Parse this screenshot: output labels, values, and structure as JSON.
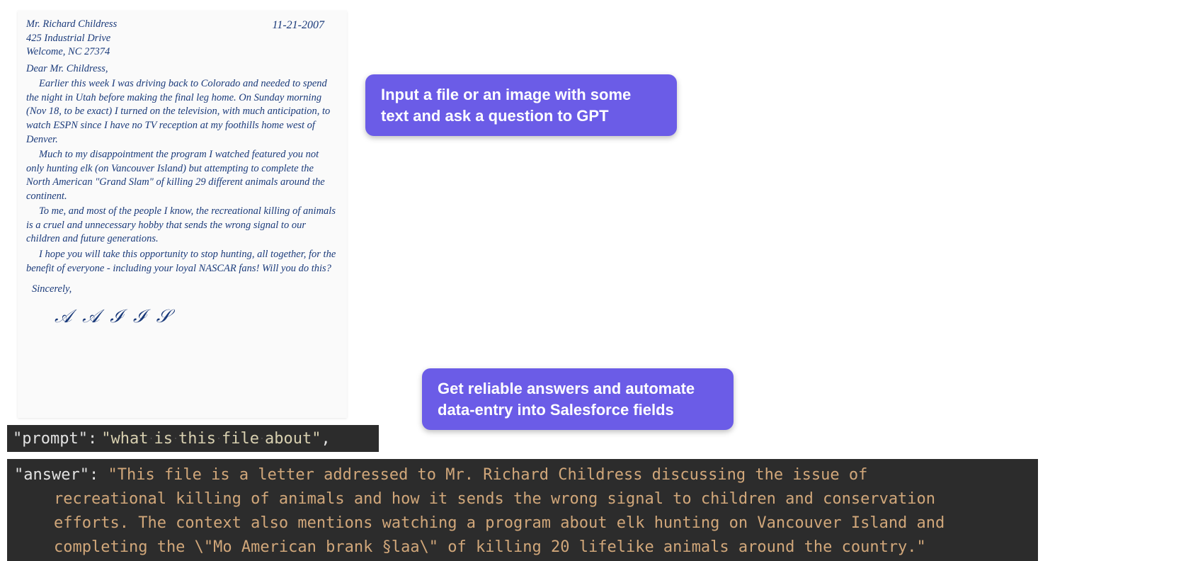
{
  "letter": {
    "name": "Mr. Richard Childress",
    "addr1": "425 Industrial Drive",
    "addr2": "Welcome, NC 27374",
    "date": "11-21-2007",
    "salutation": "Dear Mr. Childress,",
    "p1": "Earlier this week I was driving back to Colorado and needed to spend the night in Utah before making the final leg home. On Sunday morning (Nov 18, to be exact) I turned on the television, with much anticipation, to watch ESPN since I have no TV reception at my foothills home west of Denver.",
    "p2": "Much to my disappointment the program I watched featured you not only hunting elk (on Vancouver Island) but attempting to complete the North American \"Grand Slam\" of killing 29 different animals around the continent.",
    "p3": "To me, and most of the people I know, the recreational killing of animals is a cruel and unnecessary hobby that sends the wrong signal to our children and future generations.",
    "p4": "I hope you will take this opportunity to stop hunting, all together, for the benefit of everyone - including your loyal NASCAR fans! Will you do this?",
    "closing": "Sincerely,"
  },
  "callouts": {
    "input_hint": "Input a file or an image with some text and ask a question to GPT",
    "output_hint": "Get reliable answers and automate data-entry into Salesforce fields"
  },
  "code": {
    "prompt_key": "\"prompt\"",
    "prompt_value": "\"what is this file about\"",
    "answer_key": "\"answer\"",
    "answer_line1": "\"This file is a letter addressed to Mr. Richard Childress discussing the issue of",
    "answer_line2": "recreational killing of animals and how it sends the wrong signal to children and conservation",
    "answer_line3": "efforts. The context also mentions watching a program about elk hunting on Vancouver Island and",
    "answer_line4": "completing the \\\"Mo American brank §laa\\\" of killing 20 lifelike animals around the country.\""
  }
}
